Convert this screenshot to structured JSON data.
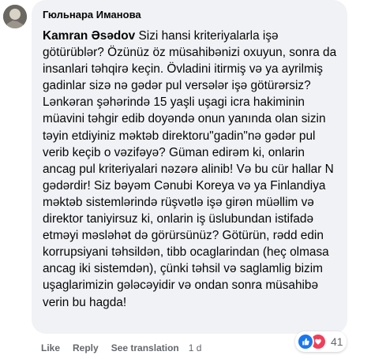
{
  "comment": {
    "author_name": "Гюльнара Иманова",
    "mention": "Kamran Əsədov",
    "body": " Sizi hansi kriteriyalarla işə götürüblər? Özünüz öz müsahibənizi oxuyun, sonra da insanlari təhqirə keçin. Övladini itirmiş və ya ayrilmiş gadinlar sizə nə gədər pul versələr işə götürərsiz? Lənkəran şəhərində 15 yaşli uşagi icra hakiminin müavini təhgir edib doyəndə onun yanında olan sizin təyin etdiyiniz məktəb direktoru\"gadin\"nə gədər pul verib keçib o vəzifəyə? Güman edirəm ki, onlarin ancag pul kriteriyalari nəzərə alinib! Və bu cür hallar N gədərdir! Siz bəyəm Cənubi Koreya və ya Finlandiya məktəb sistemlərində rüşvətlə işə girən müəllim və direktor taniyirsuz ki, onlarin iş üslubundan istifadə etməyi məsləhət də görürsünüz? Götürün, rədd edin korrupsiyani təhsildən, tibb ocaglarindan (heç olmasa ancag iki sistemdən), çünki təhsil və saglamlig bizim uşaglarimizin gələcəyidir və ondan sonra müsahibə verin bu hagda!"
  },
  "actions": {
    "like": "Like",
    "reply": "Reply",
    "see_translation": "See translation",
    "time": "1 d"
  },
  "reactions": {
    "icons": [
      "like-icon",
      "love-icon"
    ],
    "count": "41",
    "colors": {
      "like": "#1877f2",
      "love": "#f33e58"
    }
  }
}
